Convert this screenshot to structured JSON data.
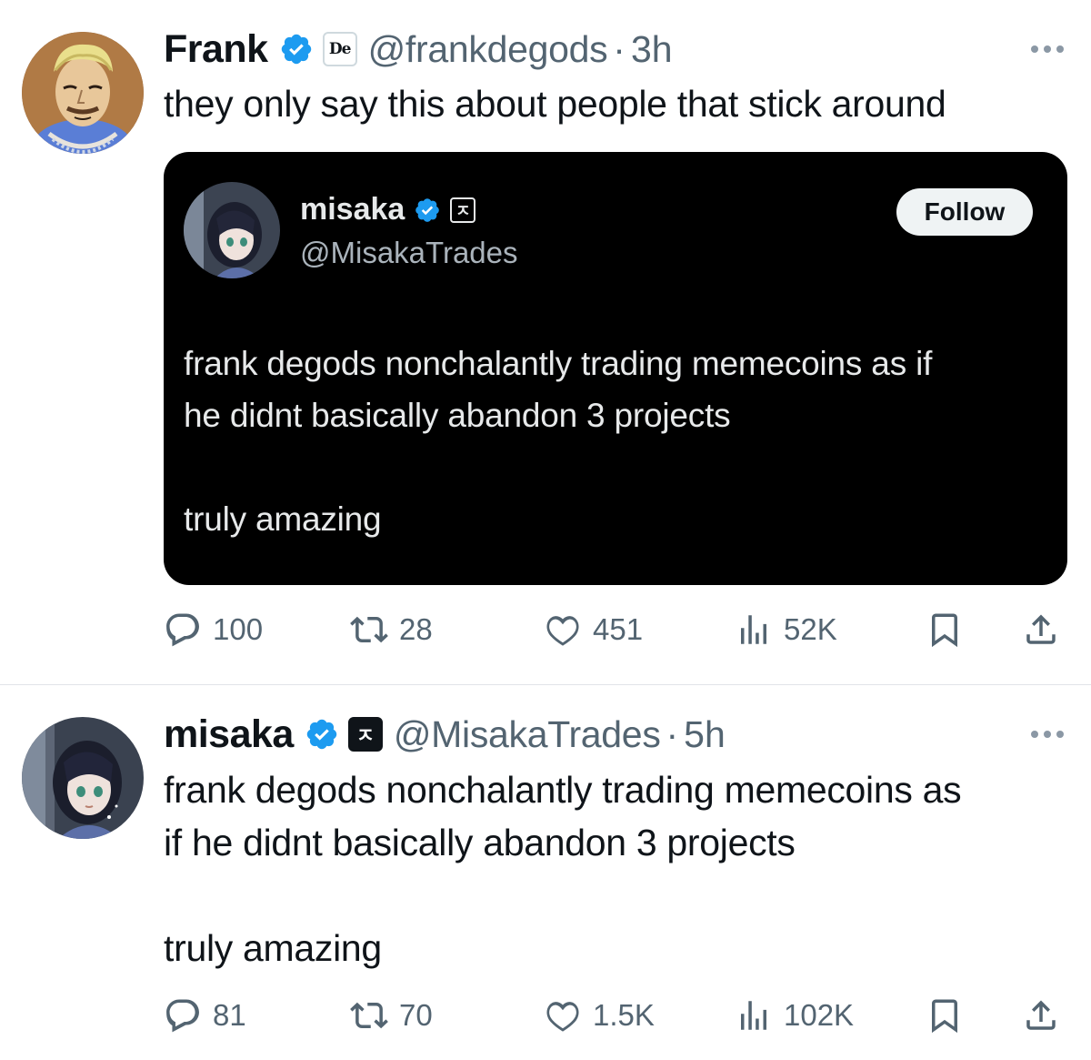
{
  "tweets": [
    {
      "author_name": "Frank",
      "affiliate_badge": "De",
      "handle": "@frankdegods",
      "time": "3h",
      "text": "they only say this about people that stick around",
      "quoted_card": {
        "author_name": "misaka",
        "affiliate_badge": "ㅈ",
        "handle": "@MisakaTrades",
        "follow_label": "Follow",
        "text": "frank degods nonchalantly trading memecoins as if\nhe didnt basically abandon 3 projects\n\ntruly amazing"
      },
      "stats": {
        "replies": "100",
        "reposts": "28",
        "likes": "451",
        "views": "52K"
      }
    },
    {
      "author_name": "misaka",
      "affiliate_badge": "ㅈ",
      "handle": "@MisakaTrades",
      "time": "5h",
      "text": "frank degods nonchalantly trading memecoins as\nif he didnt basically abandon 3 projects\n\ntruly amazing",
      "stats": {
        "replies": "81",
        "reposts": "70",
        "likes": "1.5K",
        "views": "102K"
      }
    }
  ],
  "separator": "·",
  "colors": {
    "verified": "#1d9bf0",
    "secondary_text": "#536471",
    "card_bg": "#000000"
  },
  "icons": [
    "verified-icon",
    "reply-icon",
    "repost-icon",
    "like-icon",
    "views-icon",
    "bookmark-icon",
    "share-icon",
    "more-icon"
  ]
}
